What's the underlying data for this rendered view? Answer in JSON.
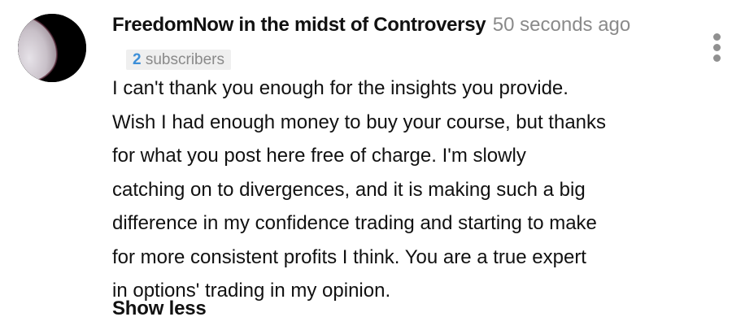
{
  "comment": {
    "author": "FreedomNow in the midst of Controversy",
    "timestamp": "50 seconds ago",
    "subscribers_count": "2",
    "subscribers_label": "subscribers",
    "text_lines": [
      "I can't thank you enough for the insights you provide.",
      "Wish I had enough money to buy your course, but thanks",
      "for what you post here free of charge. I'm slowly",
      "catching on to divergences, and it is making such a big",
      "difference in my confidence trading and starting to make",
      "for more consistent profits I think. You are a true expert",
      "in options' trading in my opinion."
    ],
    "show_less_label": "Show less"
  },
  "icons": {
    "avatar": "moon-avatar-icon",
    "menu": "more-vertical-icon"
  },
  "colors": {
    "author": "#111111",
    "timestamp": "#8a8a8a",
    "badge_background": "#efefef",
    "subscriber_count": "#3d8fd8",
    "menu_dots": "#909090"
  }
}
